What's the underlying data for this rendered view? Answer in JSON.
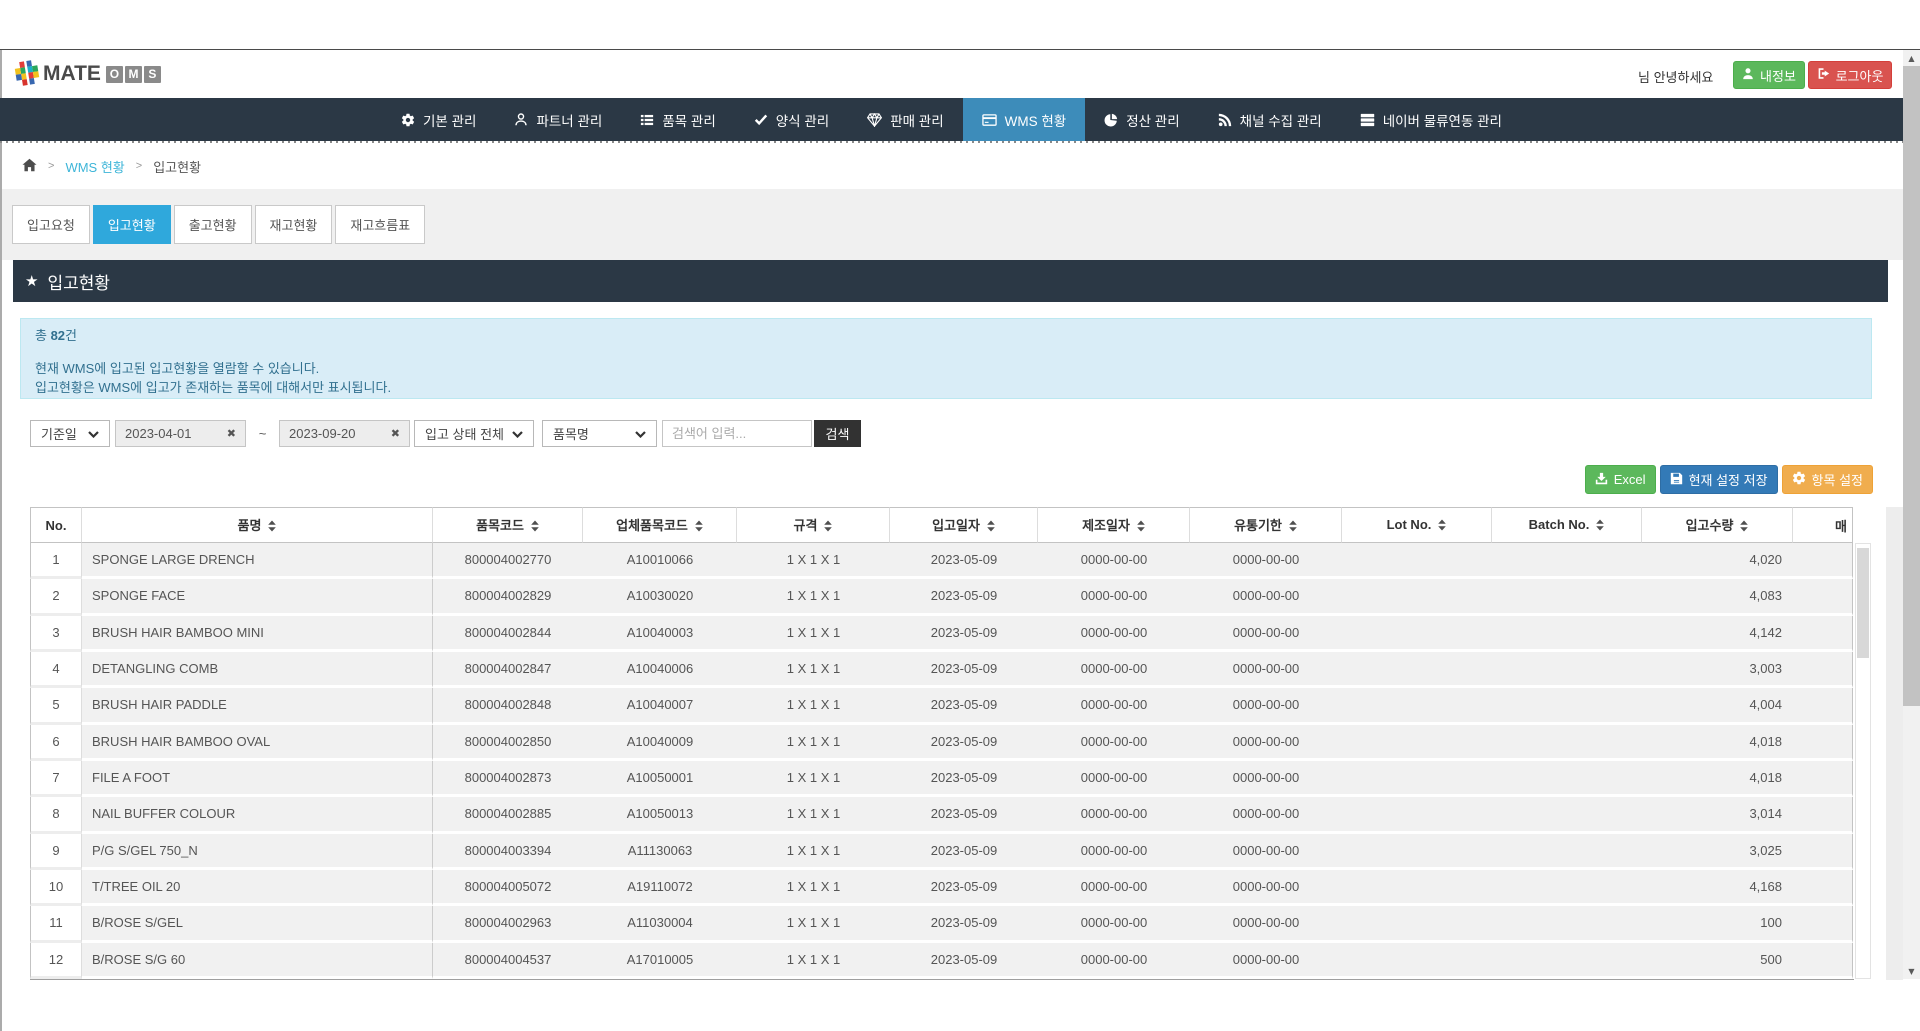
{
  "header": {
    "logo": {
      "mate": "MATE",
      "oms": [
        "O",
        "M",
        "S"
      ]
    },
    "greeting": "님 안녕하세요",
    "profile_button": "내정보",
    "logout_button": "로그아웃"
  },
  "nav": {
    "items": [
      {
        "icon": "gear-icon",
        "label": "기본 관리",
        "active": false
      },
      {
        "icon": "user-icon",
        "label": "파트너 관리",
        "active": false
      },
      {
        "icon": "list-icon",
        "label": "품목 관리",
        "active": false
      },
      {
        "icon": "check-icon",
        "label": "양식 관리",
        "active": false
      },
      {
        "icon": "gem-icon",
        "label": "판매 관리",
        "active": false
      },
      {
        "icon": "card-icon",
        "label": "WMS 현황",
        "active": true
      },
      {
        "icon": "pie-chart-icon",
        "label": "정산 관리",
        "active": false
      },
      {
        "icon": "rss-icon",
        "label": "채널 수집 관리",
        "active": false
      },
      {
        "icon": "server-icon",
        "label": "네이버 물류연동 관리",
        "active": false
      }
    ]
  },
  "breadcrumb": {
    "items": [
      {
        "label": "WMS 현황"
      },
      {
        "label": "입고현황"
      }
    ]
  },
  "tabs": [
    {
      "label": "입고요청",
      "active": false
    },
    {
      "label": "입고현황",
      "active": true
    },
    {
      "label": "출고현황",
      "active": false
    },
    {
      "label": "재고현황",
      "active": false
    },
    {
      "label": "재고흐름표",
      "active": false
    }
  ],
  "panel": {
    "title": "입고현황"
  },
  "info_box": {
    "total_prefix": "총 ",
    "total_count": "82",
    "total_suffix": "건",
    "lines": [
      "현재 WMS에 입고된 입고현황을 열람할 수 있습니다.",
      "입고현황은 WMS에 입고가 존재하는 품목에 대해서만 표시됩니다."
    ]
  },
  "filters": {
    "date_type_select": "기준일",
    "date_from": "2023-04-01",
    "date_to": "2023-09-20",
    "range_separator": "~",
    "status_select": "입고 상태 전체",
    "field_select": "품목명",
    "keyword_placeholder": "검색어 입력...",
    "search_button": "검색"
  },
  "actions": {
    "excel": "Excel",
    "save_settings": "현재 설정 저장",
    "column_settings": "항목 설정"
  },
  "table": {
    "columns": [
      {
        "label": "No.",
        "sortable": false
      },
      {
        "label": "품명",
        "sortable": true
      },
      {
        "label": "품목코드",
        "sortable": true
      },
      {
        "label": "업체품목코드",
        "sortable": true
      },
      {
        "label": "규격",
        "sortable": true
      },
      {
        "label": "입고일자",
        "sortable": true
      },
      {
        "label": "제조일자",
        "sortable": true
      },
      {
        "label": "유통기한",
        "sortable": true
      },
      {
        "label": "Lot No.",
        "sortable": true
      },
      {
        "label": "Batch No.",
        "sortable": true
      },
      {
        "label": "입고수량",
        "sortable": true
      },
      {
        "label": "매",
        "sortable": false
      }
    ],
    "rows": [
      {
        "no": "1",
        "name": "SPONGE LARGE DRENCH",
        "item_code": "800004002770",
        "vendor_item_code": "A10010066",
        "spec": "1 X 1 X 1",
        "in_date": "2023-05-09",
        "mfg_date": "0000-00-00",
        "expiry": "0000-00-00",
        "lot_no": "",
        "batch_no": "",
        "qty": "4,020",
        "stub": ""
      },
      {
        "no": "2",
        "name": "SPONGE FACE",
        "item_code": "800004002829",
        "vendor_item_code": "A10030020",
        "spec": "1 X 1 X 1",
        "in_date": "2023-05-09",
        "mfg_date": "0000-00-00",
        "expiry": "0000-00-00",
        "lot_no": "",
        "batch_no": "",
        "qty": "4,083",
        "stub": ""
      },
      {
        "no": "3",
        "name": "BRUSH HAIR BAMBOO MINI",
        "item_code": "800004002844",
        "vendor_item_code": "A10040003",
        "spec": "1 X 1 X 1",
        "in_date": "2023-05-09",
        "mfg_date": "0000-00-00",
        "expiry": "0000-00-00",
        "lot_no": "",
        "batch_no": "",
        "qty": "4,142",
        "stub": ""
      },
      {
        "no": "4",
        "name": "DETANGLING COMB",
        "item_code": "800004002847",
        "vendor_item_code": "A10040006",
        "spec": "1 X 1 X 1",
        "in_date": "2023-05-09",
        "mfg_date": "0000-00-00",
        "expiry": "0000-00-00",
        "lot_no": "",
        "batch_no": "",
        "qty": "3,003",
        "stub": ""
      },
      {
        "no": "5",
        "name": "BRUSH HAIR PADDLE",
        "item_code": "800004002848",
        "vendor_item_code": "A10040007",
        "spec": "1 X 1 X 1",
        "in_date": "2023-05-09",
        "mfg_date": "0000-00-00",
        "expiry": "0000-00-00",
        "lot_no": "",
        "batch_no": "",
        "qty": "4,004",
        "stub": ""
      },
      {
        "no": "6",
        "name": "BRUSH HAIR BAMBOO OVAL",
        "item_code": "800004002850",
        "vendor_item_code": "A10040009",
        "spec": "1 X 1 X 1",
        "in_date": "2023-05-09",
        "mfg_date": "0000-00-00",
        "expiry": "0000-00-00",
        "lot_no": "",
        "batch_no": "",
        "qty": "4,018",
        "stub": ""
      },
      {
        "no": "7",
        "name": "FILE A FOOT",
        "item_code": "800004002873",
        "vendor_item_code": "A10050001",
        "spec": "1 X 1 X 1",
        "in_date": "2023-05-09",
        "mfg_date": "0000-00-00",
        "expiry": "0000-00-00",
        "lot_no": "",
        "batch_no": "",
        "qty": "4,018",
        "stub": ""
      },
      {
        "no": "8",
        "name": "NAIL BUFFER COLOUR",
        "item_code": "800004002885",
        "vendor_item_code": "A10050013",
        "spec": "1 X 1 X 1",
        "in_date": "2023-05-09",
        "mfg_date": "0000-00-00",
        "expiry": "0000-00-00",
        "lot_no": "",
        "batch_no": "",
        "qty": "3,014",
        "stub": ""
      },
      {
        "no": "9",
        "name": "P/G S/GEL 750_N",
        "item_code": "800004003394",
        "vendor_item_code": "A11130063",
        "spec": "1 X 1 X 1",
        "in_date": "2023-05-09",
        "mfg_date": "0000-00-00",
        "expiry": "0000-00-00",
        "lot_no": "",
        "batch_no": "",
        "qty": "3,025",
        "stub": ""
      },
      {
        "no": "10",
        "name": "T/TREE OIL 20",
        "item_code": "800004005072",
        "vendor_item_code": "A19110072",
        "spec": "1 X 1 X 1",
        "in_date": "2023-05-09",
        "mfg_date": "0000-00-00",
        "expiry": "0000-00-00",
        "lot_no": "",
        "batch_no": "",
        "qty": "4,168",
        "stub": ""
      },
      {
        "no": "11",
        "name": "B/ROSE S/GEL",
        "item_code": "800004002963",
        "vendor_item_code": "A11030004",
        "spec": "1 X 1 X 1",
        "in_date": "2023-05-09",
        "mfg_date": "0000-00-00",
        "expiry": "0000-00-00",
        "lot_no": "",
        "batch_no": "",
        "qty": "100",
        "stub": ""
      },
      {
        "no": "12",
        "name": "B/ROSE S/G 60",
        "item_code": "800004004537",
        "vendor_item_code": "A17010005",
        "spec": "1 X 1 X 1",
        "in_date": "2023-05-09",
        "mfg_date": "0000-00-00",
        "expiry": "0000-00-00",
        "lot_no": "",
        "batch_no": "",
        "qty": "500",
        "stub": ""
      }
    ]
  },
  "colors": {
    "navbar": "#2b3845",
    "nav_active": "#3d8cba",
    "tab_active": "#2fa8dc",
    "link": "#3db5d8",
    "info_bg": "#d9edf7",
    "info_border": "#bce8f1",
    "info_text": "#31708f",
    "excel": "#5cb85c",
    "save": "#337ab7",
    "settings": "#f0ad4e",
    "profile": "#5cb85c",
    "logout": "#d9534f",
    "search_btn": "#323232"
  }
}
